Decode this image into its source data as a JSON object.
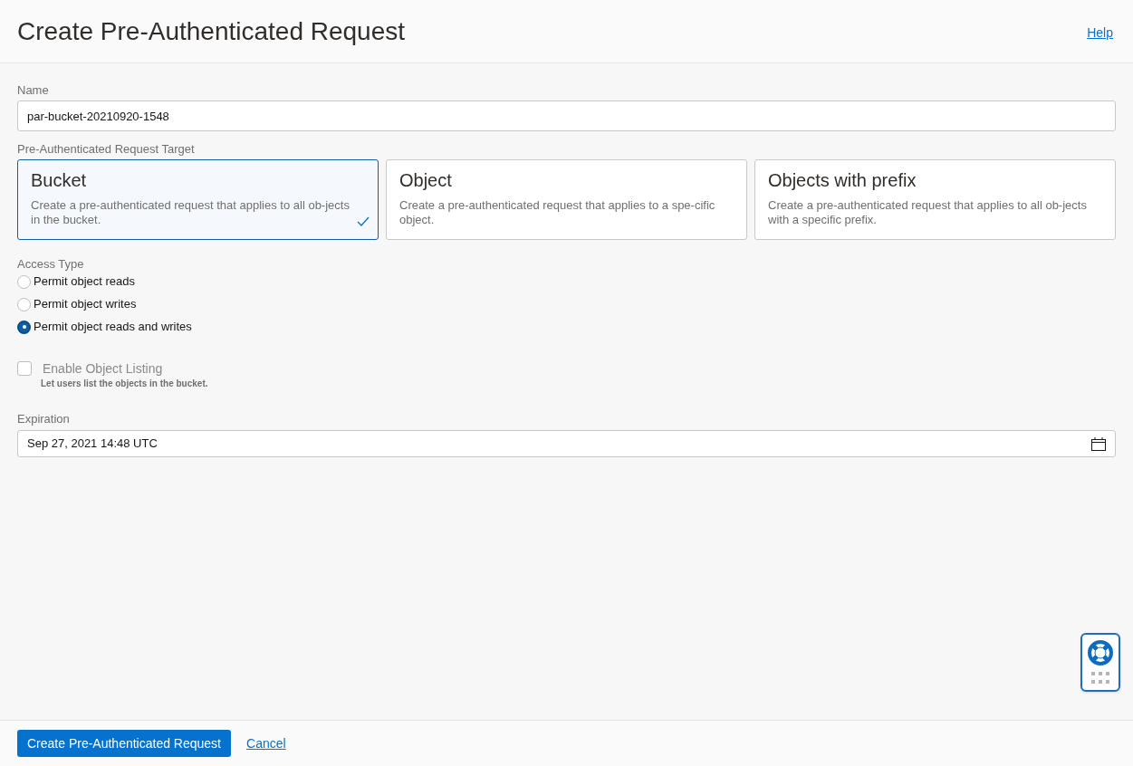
{
  "header": {
    "title": "Create Pre-Authenticated Request",
    "help_link": "Help"
  },
  "name_field": {
    "label": "Name",
    "value": "par-bucket-20210920-1548"
  },
  "target": {
    "label": "Pre-Authenticated Request Target",
    "options": [
      {
        "title": "Bucket",
        "description": "Create a pre-authenticated request that applies to all ob-jects in the bucket.",
        "selected": true
      },
      {
        "title": "Object",
        "description": "Create a pre-authenticated request that applies to a spe-cific object.",
        "selected": false
      },
      {
        "title": "Objects with prefix",
        "description": "Create a pre-authenticated request that applies to all ob-jects with a specific prefix.",
        "selected": false
      }
    ]
  },
  "access_type": {
    "label": "Access Type",
    "options": [
      {
        "label": "Permit object reads",
        "selected": false
      },
      {
        "label": "Permit object writes",
        "selected": false
      },
      {
        "label": "Permit object reads and writes",
        "selected": true
      }
    ]
  },
  "object_listing": {
    "label": "Enable Object Listing",
    "hint": "Let users list the objects in the bucket.",
    "checked": false
  },
  "expiration": {
    "label": "Expiration",
    "value": "Sep 27, 2021 14:48 UTC"
  },
  "footer": {
    "primary_button": "Create Pre-Authenticated Request",
    "cancel_link": "Cancel"
  }
}
